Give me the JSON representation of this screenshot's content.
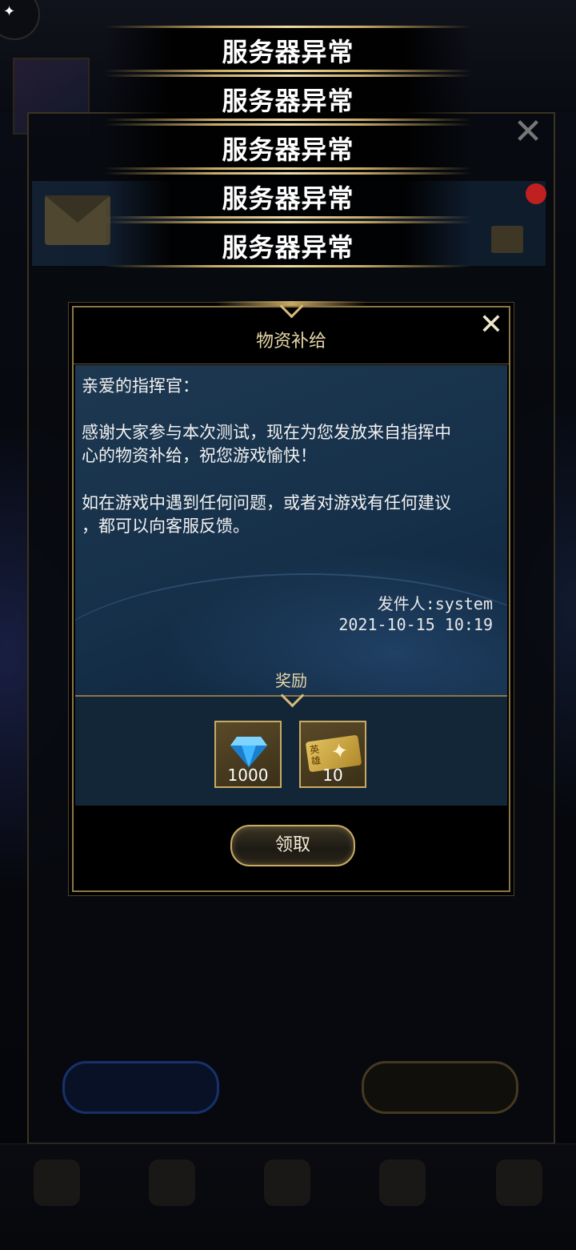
{
  "toasts": [
    "服务器异常",
    "服务器异常",
    "服务器异常",
    "服务器异常",
    "服务器异常"
  ],
  "dialog": {
    "title": "物资补给",
    "close_icon": "close-icon",
    "greeting": "亲爱的指挥官：",
    "paragraph1_line1": "感谢大家参与本次测试，现在为您发放来自指挥中",
    "paragraph1_line2": "心的物资补给，祝您游戏愉快！",
    "paragraph2_line1": "如在游戏中遇到任何问题，或者对游戏有任何建议",
    "paragraph2_line2": "，都可以向客服反馈。",
    "sender": "发件人:system",
    "date": "2021-10-15 10:19",
    "reward_label": "奖励",
    "rewards": [
      {
        "icon": "diamond-icon",
        "count": "1000"
      },
      {
        "icon": "hero-ticket-icon",
        "count": "10"
      }
    ],
    "claim_button": "领取"
  },
  "colors": {
    "gold": "#c9aa64",
    "dialog_bg": "#000000",
    "message_bg": "#16304a",
    "toast_text": "#ffffff"
  }
}
